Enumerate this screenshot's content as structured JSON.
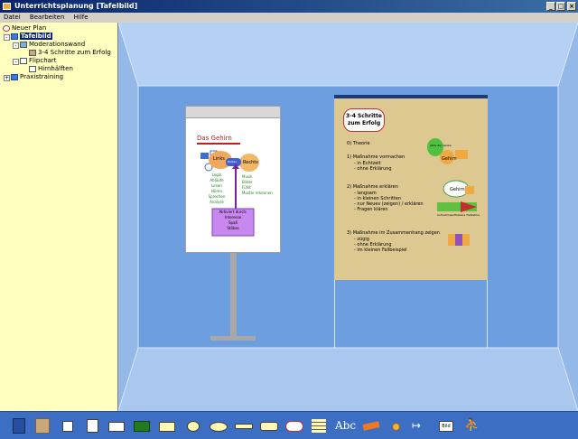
{
  "window": {
    "title": "Unterrichtsplanung [Tafelbild]"
  },
  "menu": [
    "Datei",
    "Bearbeiten",
    "Hilfe"
  ],
  "tree": [
    {
      "label": "Neuer Plan"
    },
    {
      "label": "Tafelbild"
    },
    {
      "label": "Moderationswand"
    },
    {
      "label": "3-4 Schritte zum Erfolg"
    },
    {
      "label": "Flipchart"
    },
    {
      "label": "Hirnhälften"
    },
    {
      "label": "Praxistraining"
    }
  ],
  "flipchart": {
    "title": "Das Gehirn",
    "left": "Links",
    "center": "Balken",
    "right": "Rechts",
    "left_list": [
      "Logik",
      "Abläufe",
      "Lesen",
      "Hören",
      "Sprechen",
      "Analyse"
    ],
    "right_list": [
      "Musik",
      "Bilder",
      "Fühlt",
      "Muster erkennen"
    ],
    "box": [
      "Aktiviert durch:",
      "Interesse",
      "Spaß",
      "Stäkes"
    ]
  },
  "modwall": {
    "title": "3-4 Schritte zum Erfolg",
    "sections": [
      {
        "head": "0) Theorie",
        "items": []
      },
      {
        "head": "1) Maßnahme vormachen",
        "items": [
          "- in Echtzeit",
          "- ohne Erklärung"
        ]
      },
      {
        "head": "2) Maßnahme erklären",
        "items": [
          "- langsam",
          "- in kleinen Schritten",
          "- nur Neues (zeigen) / erklären",
          "- Fragen klären"
        ]
      },
      {
        "head": "3) Maßnahme im Zusammenhang zeigen",
        "items": [
          "- zügig",
          "- ohne Erklärung",
          "- im kleinen Fallbeispiel"
        ]
      }
    ],
    "side_labels": {
      "card": "aktiv der starke",
      "gehirn1": "Gehirn",
      "gehirn2": "Gehirn",
      "bar": "Aufnahmeauflösbare Tiefestöre"
    }
  },
  "toolbar_items": [
    "blue-card-icon",
    "tan-card-icon",
    "person-card-icon",
    "white-card-icon",
    "wide-card-icon",
    "green-cards-icon",
    "tab-card-icon",
    "round-tab-icon",
    "ellipse-icon",
    "strip-icon",
    "hexagon-icon",
    "cloud-icon",
    "table-icon",
    "text-icon",
    "marker-icon",
    "pin-icon",
    "arrow-icon",
    "image-icon",
    "figure-icon"
  ],
  "toolbar_text": {
    "abc": "Abc",
    "bild": "Bild"
  }
}
